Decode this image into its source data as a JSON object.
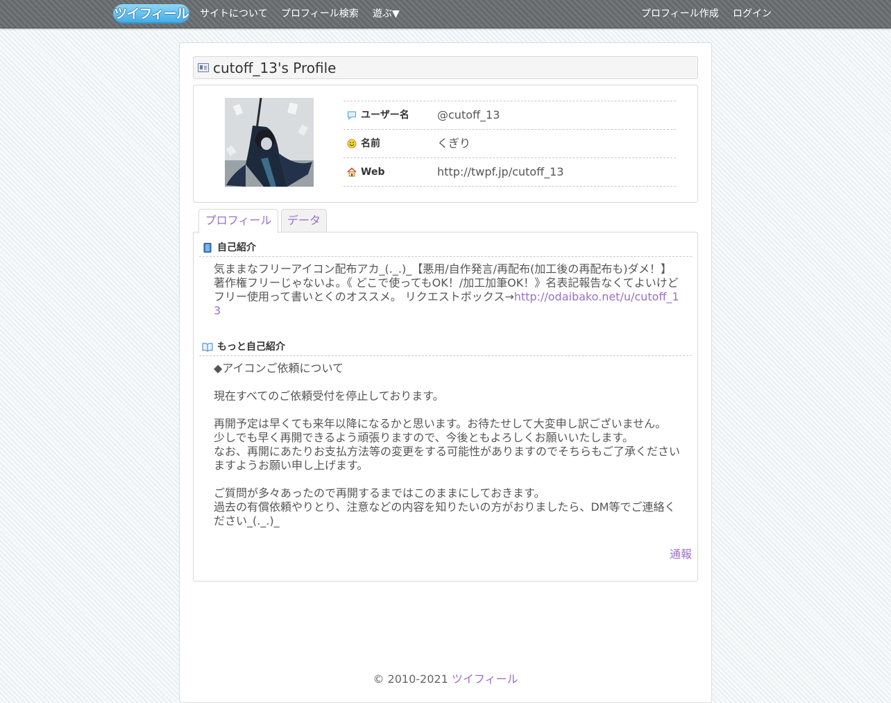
{
  "nav": {
    "logo": "ツイフィール",
    "links": [
      "サイトについて",
      "プロフィール検索",
      "遊ぶ▼"
    ],
    "right_links": [
      "プロフィール作成",
      "ログイン"
    ]
  },
  "profile": {
    "title": "cutoff_13's Profile",
    "rows": [
      {
        "icon": "speech-bubble-icon",
        "label": "ユーザー名",
        "value": "@cutoff_13"
      },
      {
        "icon": "smiley-face-icon",
        "label": "名前",
        "value": "くぎり"
      },
      {
        "icon": "house-icon",
        "label": "Web",
        "value": "http://twpf.jp/cutoff_13"
      }
    ]
  },
  "tabs": [
    "プロフィール",
    "データ"
  ],
  "bio": {
    "heading": "自己紹介",
    "text": "気ままなフリーアイコン配布アカ_(._.)_【悪用/自作発言/再配布(加工後の再配布も)ダメ！】著作権フリーじゃないよ。《 どこで使ってもOK！/加工加筆OK！》名表記報告なくてよいけどフリー使用って書いとくのオススメ。 リクエストボックス→",
    "link": "http://odaibako.net/u/cutoff_13"
  },
  "more_bio": {
    "heading": "もっと自己紹介",
    "lines": [
      "◆アイコンご依頼について",
      "",
      "現在すべてのご依頼受付を停止しております。",
      "",
      "再開予定は早くても来年以降になるかと思います。お待たせして大変申し訳ございません。",
      "少しでも早く再開できるよう頑張りますので、今後ともよろしくお願いいたします。",
      "なお、再開にあたりお支払方法等の変更をする可能性がありますのでそちらもご了承くださいますようお願い申し上げます。",
      "",
      "ご質問が多々あったので再開するまではこのままにしておきます。",
      "過去の有償依頼やりとり、注意などの内容を知りたいの方がおりましたら、DM等でご連絡ください_(._.)_"
    ]
  },
  "report": "通報",
  "footer": {
    "copyright": "© 2010-2021",
    "site": "ツイフィール"
  },
  "colors": {
    "link": "#9c6ec9",
    "nav_bg": "#6b6e70",
    "logo": "#3fa9e6"
  }
}
